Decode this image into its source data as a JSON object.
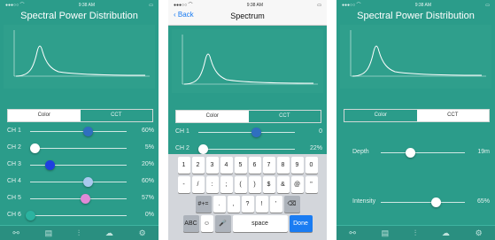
{
  "screen1": {
    "title": "Spectral Power Distribution",
    "tabs": [
      "Color",
      "CCT"
    ],
    "channels": [
      {
        "label": "CH 1",
        "value": "60%",
        "level": 0.6,
        "color": "#2f6fbf"
      },
      {
        "label": "CH 2",
        "value": "5%",
        "level": 0.05,
        "color": "#ffffff"
      },
      {
        "label": "CH 3",
        "value": "20%",
        "level": 0.2,
        "color": "#1f3fe0"
      },
      {
        "label": "CH 4",
        "value": "60%",
        "level": 0.6,
        "color": "#a9c9ef"
      },
      {
        "label": "CH 5",
        "value": "57%",
        "level": 0.57,
        "color": "#e08ad8"
      },
      {
        "label": "CH 6",
        "value": "0%",
        "level": 0.0,
        "color": "#2bb3a0"
      }
    ]
  },
  "screen2": {
    "back": "Back",
    "title": "Spectrum",
    "tabs": [
      "Color",
      "CCT"
    ],
    "rows": [
      {
        "label": "CH 1",
        "value": "0",
        "level": 0.6,
        "color": "#2f6fbf"
      },
      {
        "label": "CH 2",
        "value": "22%",
        "level": 0.05,
        "color": "#ffffff"
      }
    ],
    "keyboard": {
      "row1": [
        "1",
        "2",
        "3",
        "4",
        "5",
        "6",
        "7",
        "8",
        "9",
        "0"
      ],
      "row2": [
        "-",
        "/",
        ":",
        ";",
        "(",
        ")",
        "$",
        "&",
        "@",
        "\""
      ],
      "row3": [
        "#+=",
        ".",
        ",",
        "?",
        "!",
        "'",
        "⌫"
      ],
      "row4": [
        "ABC",
        "☺",
        "🎤",
        "space",
        "Done"
      ]
    }
  },
  "screen3": {
    "title": "Spectral Power Distribution",
    "tabs": [
      "Color",
      "CCT"
    ],
    "depth": {
      "label": "Depth",
      "value": "19m",
      "level": 0.35
    },
    "intensity": {
      "label": "Intensity",
      "value": "65%",
      "level": 0.65
    }
  },
  "tabbar_icons": [
    "fixture-icon",
    "spectrum-icon",
    "sliders-icon",
    "cloud-icon",
    "settings-icon"
  ],
  "colors": {
    "teal": "#2b9c8a",
    "accent_blue": "#1a7cf2"
  }
}
